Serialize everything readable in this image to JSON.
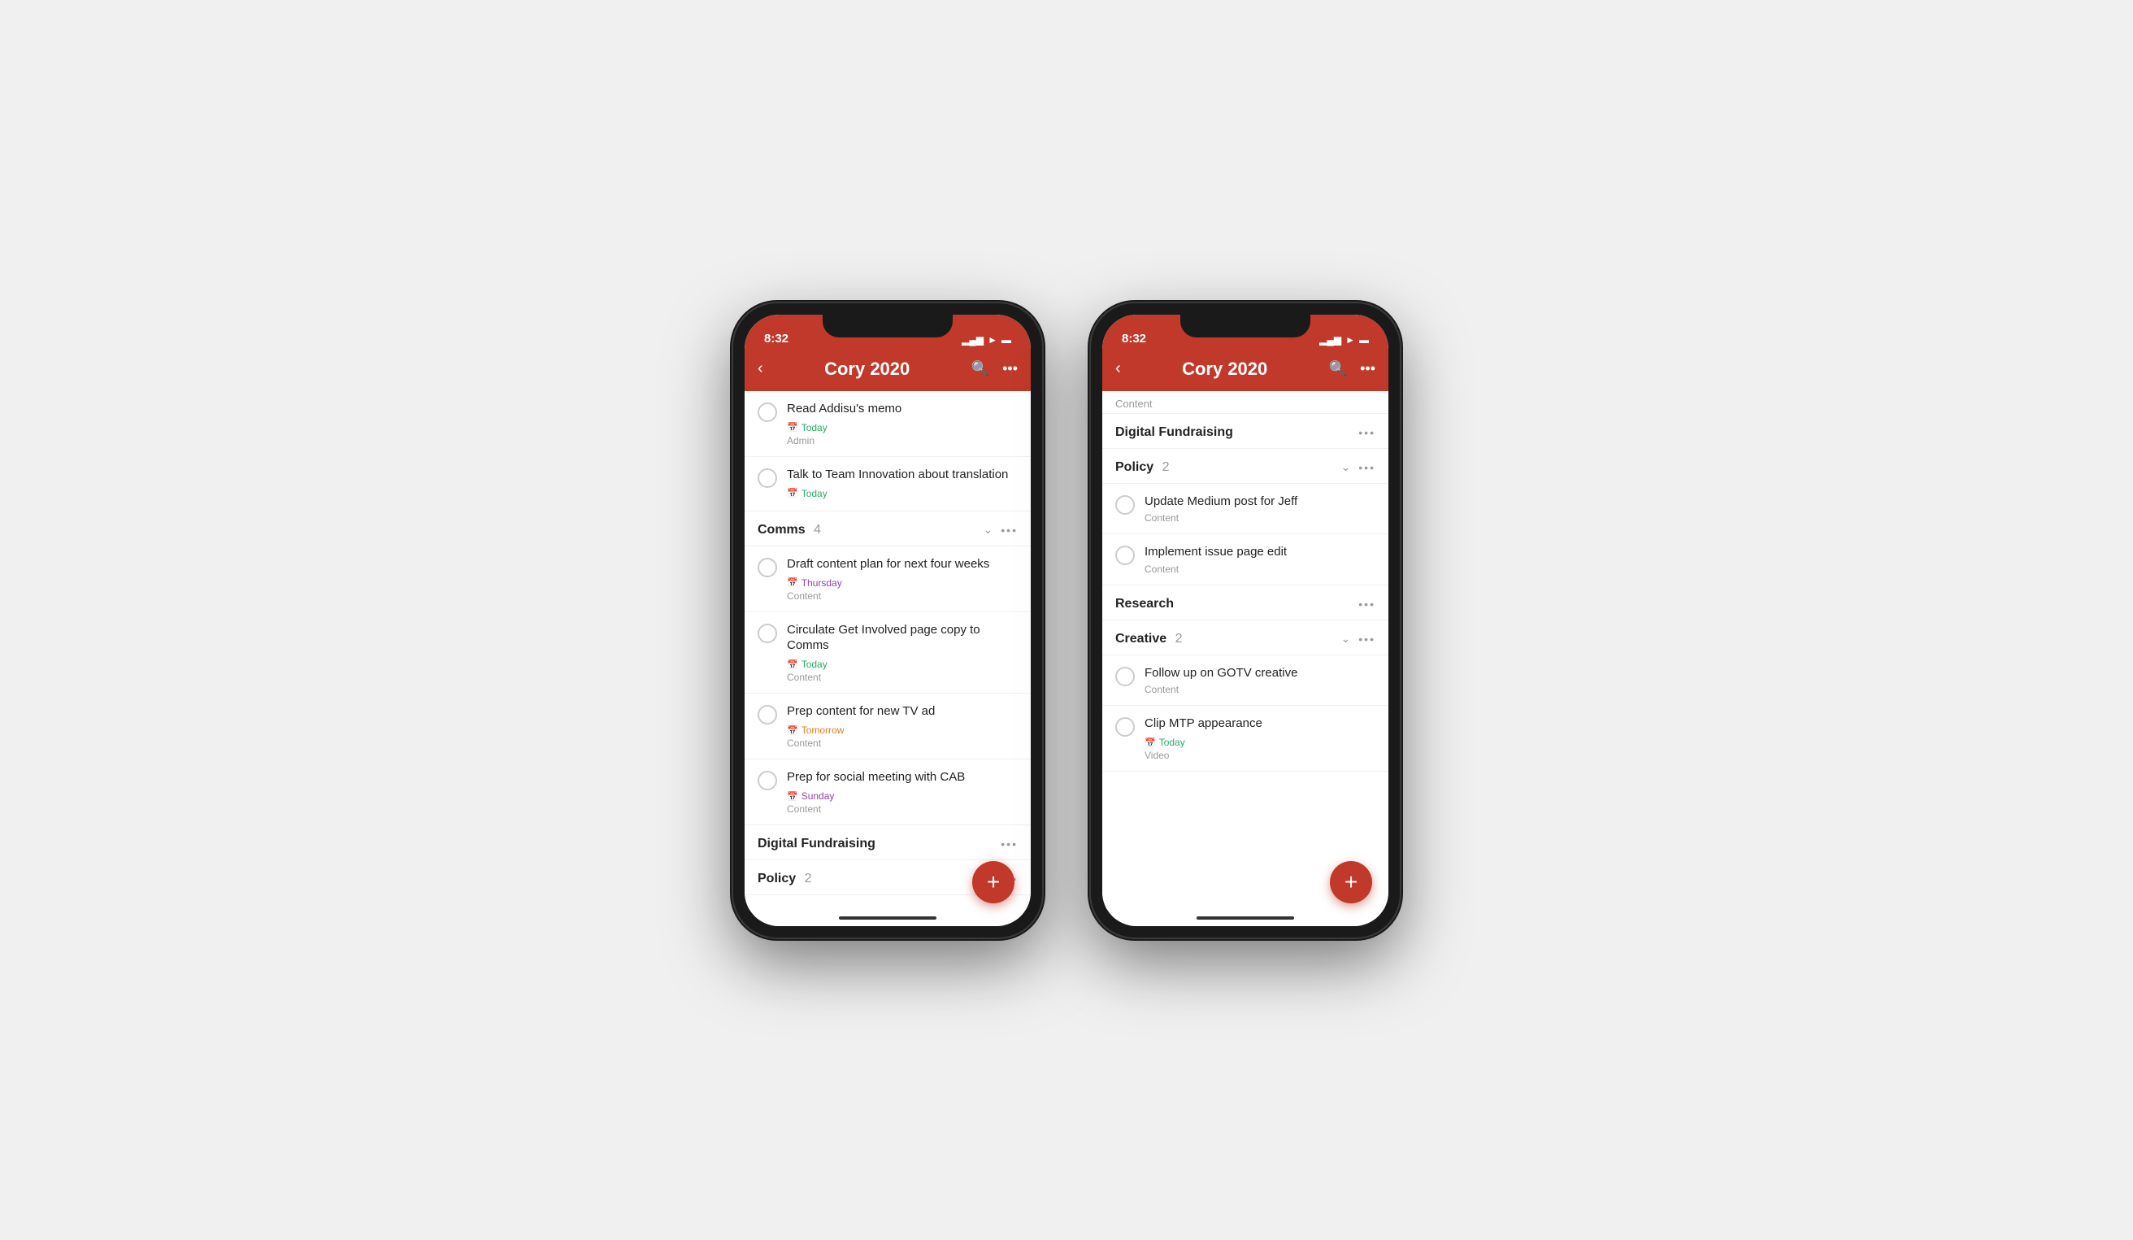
{
  "phones": [
    {
      "id": "phone1",
      "status_bar": {
        "time": "8:32",
        "signal": "▂▄▆",
        "wifi": "wifi",
        "battery": "battery"
      },
      "header": {
        "title": "Cory 2020",
        "back_label": "‹",
        "search_label": "search",
        "more_label": "•••"
      },
      "tasks": [
        {
          "id": "t1",
          "title": "Read Addisu's memo",
          "date": "Today",
          "date_type": "today",
          "tag": "Admin"
        },
        {
          "id": "t2",
          "title": "Talk to Team Innovation about translation",
          "date": "Today",
          "date_type": "today",
          "tag": ""
        }
      ],
      "sections": [
        {
          "id": "comms",
          "title": "Comms",
          "count": "4",
          "has_chevron": true,
          "tasks": [
            {
              "id": "c1",
              "title": "Draft content plan for next four weeks",
              "date": "Thursday",
              "date_type": "thursday",
              "tag": "Content"
            },
            {
              "id": "c2",
              "title": "Circulate Get Involved page copy to Comms",
              "date": "Today",
              "date_type": "today",
              "tag": "Content"
            },
            {
              "id": "c3",
              "title": "Prep content for new TV ad",
              "date": "Tomorrow",
              "date_type": "tomorrow",
              "tag": "Content"
            },
            {
              "id": "c4",
              "title": "Prep for social meeting with CAB",
              "date": "Sunday",
              "date_type": "sunday",
              "tag": "Content"
            }
          ]
        },
        {
          "id": "digital_fundraising",
          "title": "Digital Fundraising",
          "count": "",
          "has_chevron": false,
          "tasks": []
        },
        {
          "id": "policy",
          "title": "Policy",
          "count": "2",
          "has_chevron": true,
          "tasks": []
        }
      ]
    },
    {
      "id": "phone2",
      "status_bar": {
        "time": "8:32",
        "signal": "▂▄▆",
        "wifi": "wifi",
        "battery": "battery"
      },
      "header": {
        "title": "Cory 2020",
        "back_label": "‹",
        "search_label": "search",
        "more_label": "•••"
      },
      "top_label": "Content",
      "sections": [
        {
          "id": "digital_fundraising2",
          "title": "Digital Fundraising",
          "count": "",
          "has_chevron": false,
          "tasks": []
        },
        {
          "id": "policy2",
          "title": "Policy",
          "count": "2",
          "has_chevron": true,
          "tasks": [
            {
              "id": "p1",
              "title": "Update Medium post for Jeff",
              "date": "",
              "date_type": "",
              "tag": "Content"
            },
            {
              "id": "p2",
              "title": "Implement issue page edit",
              "date": "",
              "date_type": "",
              "tag": "Content"
            }
          ]
        },
        {
          "id": "research2",
          "title": "Research",
          "count": "",
          "has_chevron": false,
          "tasks": []
        },
        {
          "id": "creative2",
          "title": "Creative",
          "count": "2",
          "has_chevron": true,
          "tasks": [
            {
              "id": "cr1",
              "title": "Follow up on GOTV creative",
              "date": "",
              "date_type": "",
              "tag": "Content"
            },
            {
              "id": "cr2",
              "title": "Clip MTP appearance",
              "date": "Today",
              "date_type": "today",
              "tag": "Video"
            }
          ]
        }
      ]
    }
  ],
  "labels": {
    "add": "+",
    "today": "Today",
    "thursday": "Thursday",
    "tomorrow": "Tomorrow",
    "sunday": "Sunday"
  }
}
